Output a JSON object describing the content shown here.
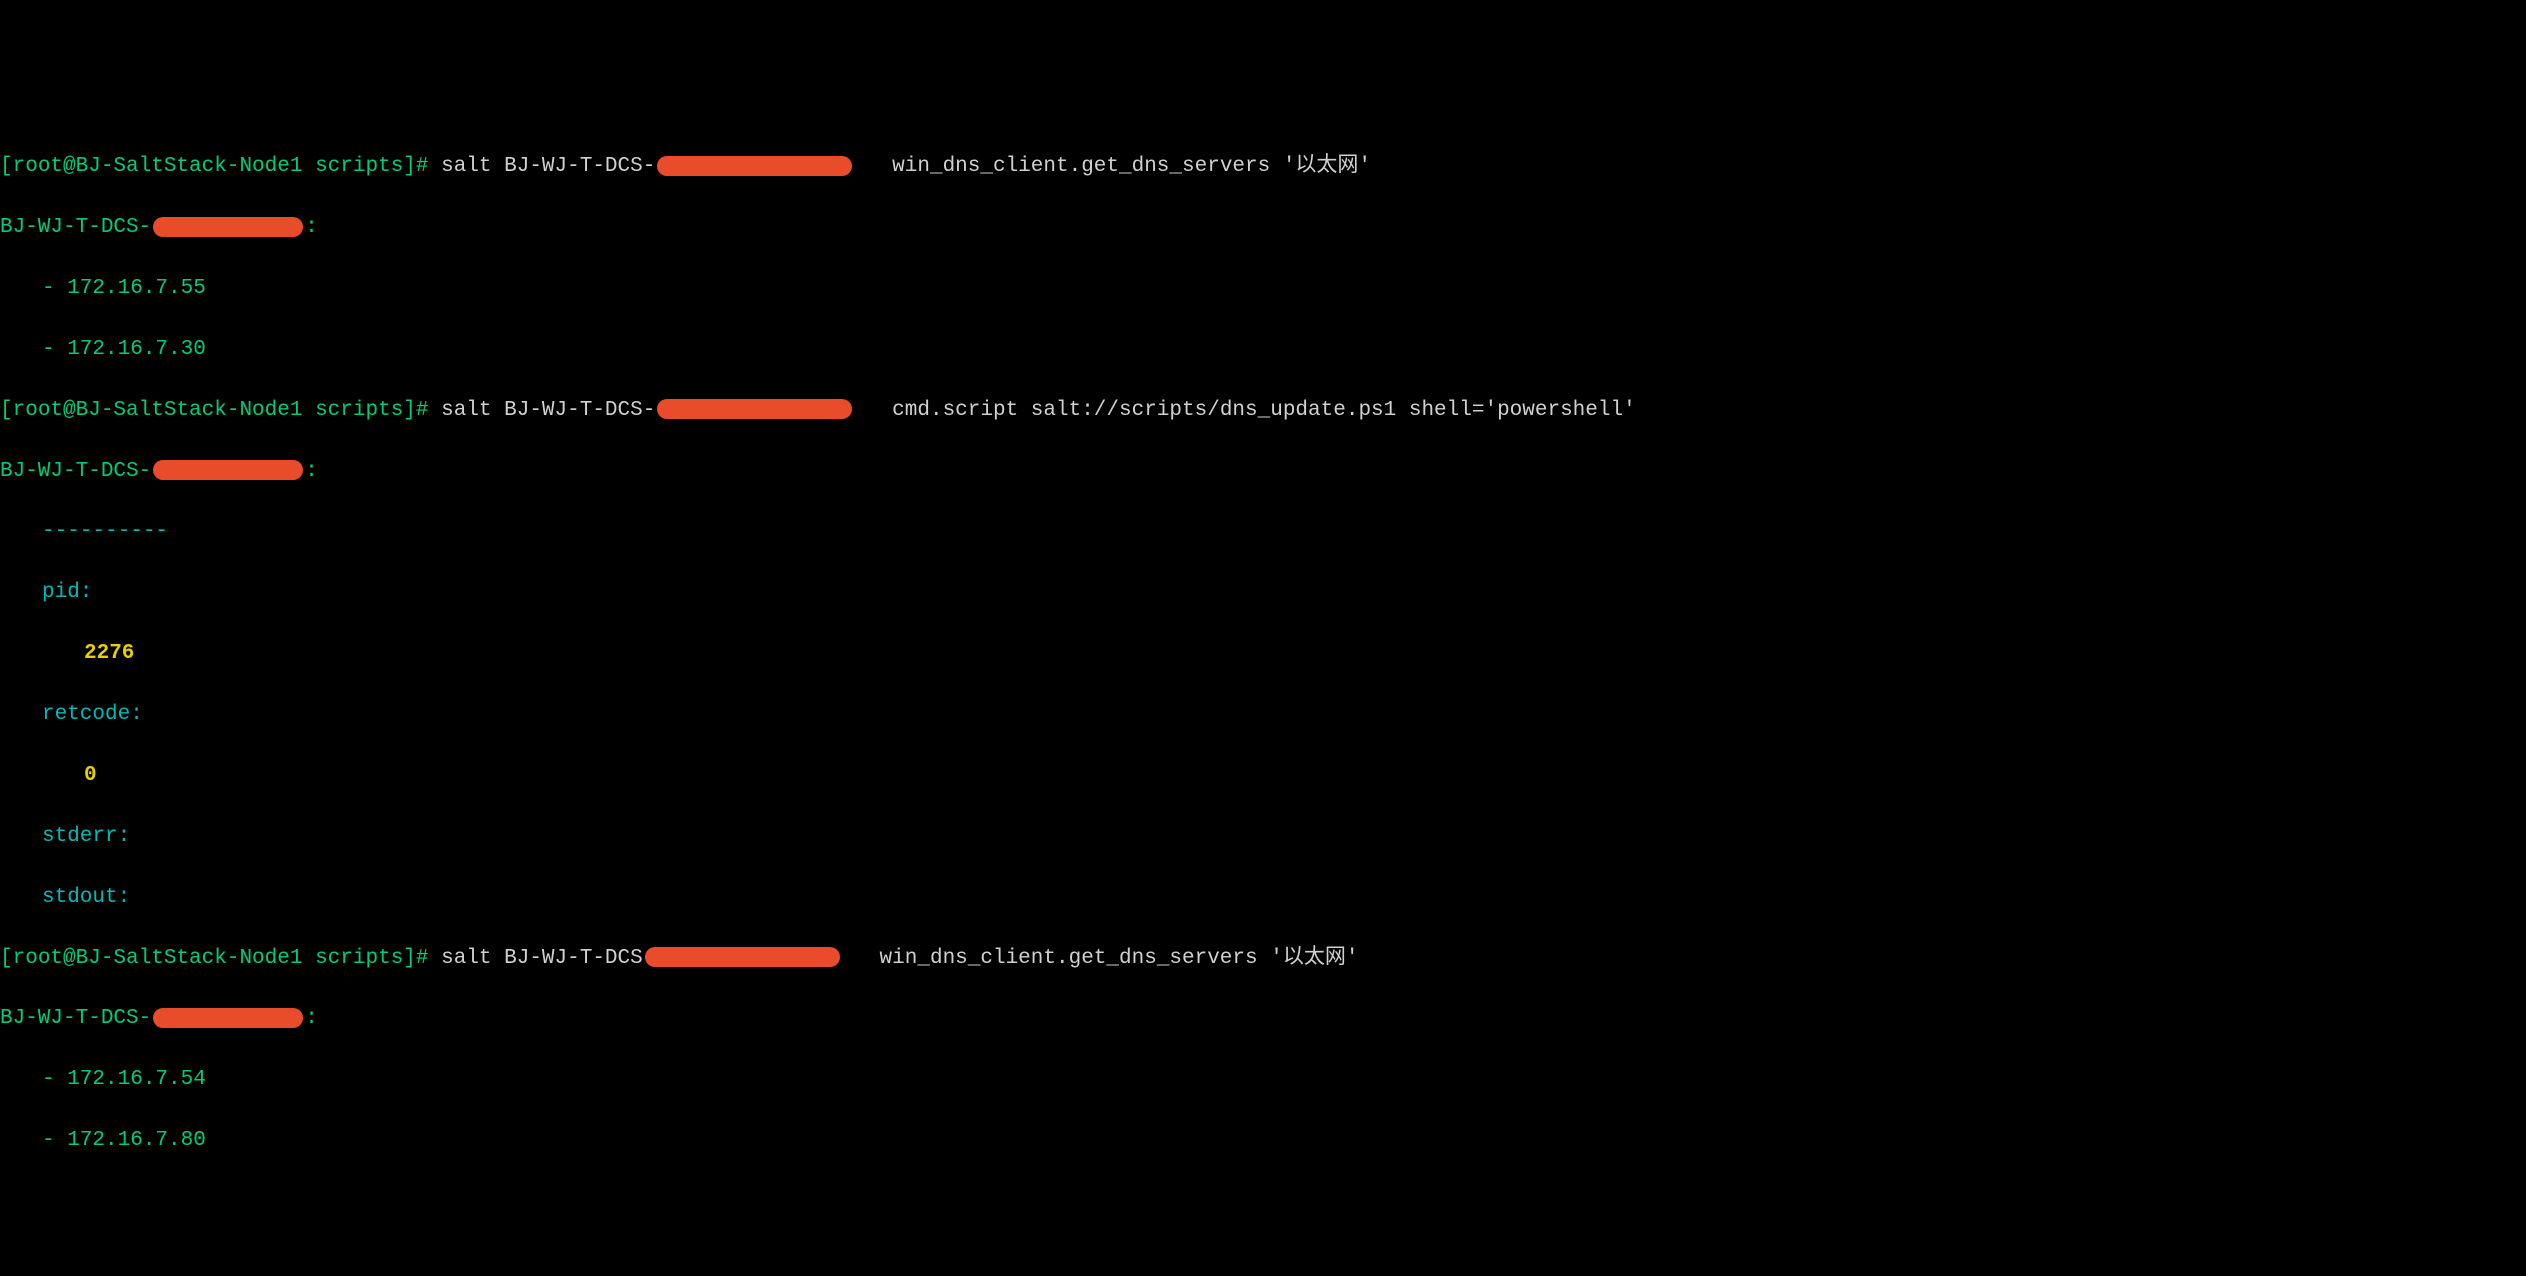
{
  "lines": {
    "l1_prompt_open": "[",
    "l1_userhost": "root@BJ-SaltStack-Node1",
    "l1_space1": " ",
    "l1_path": "scripts",
    "l1_prompt_close": "]# ",
    "l1_cmd1": "salt BJ-WJ-T-DCS-",
    "l1_cmd2": "   win_dns_client.get_dns_servers '以太网'",
    "l2_minion": "BJ-WJ-T-DCS-",
    "l2_colon": ":",
    "l3_item": "- 172.16.7.55",
    "l4_item": "- 172.16.7.30",
    "l5_prompt_open": "[",
    "l5_userhost": "root@BJ-SaltStack-Node1",
    "l5_space1": " ",
    "l5_path": "scripts",
    "l5_prompt_close": "]# ",
    "l5_cmd1": "salt BJ-WJ-T-DCS-",
    "l5_cmd2": "   cmd.script salt://scripts/dns_update.ps1 shell='powershell'",
    "l6_minion": "BJ-WJ-T-DCS-",
    "l6_colon": ":",
    "l7_sep": "----------",
    "l8_key": "pid:",
    "l9_val": "2276",
    "l10_key": "retcode:",
    "l11_val": "0",
    "l12_key": "stderr:",
    "l13_key": "stdout:",
    "l14_prompt_open": "[",
    "l14_userhost": "root@BJ-SaltStack-Node1",
    "l14_space1": " ",
    "l14_path": "scripts",
    "l14_prompt_close": "]# ",
    "l14_cmd1": "salt BJ-WJ-T-DCS",
    "l14_cmd2": "   win_dns_client.get_dns_servers '以太网'",
    "l15_minion": "BJ-WJ-T-DCS-",
    "l15_colon": ":",
    "l16_item": "- 172.16.7.54",
    "l17_item": "- 172.16.7.80"
  }
}
